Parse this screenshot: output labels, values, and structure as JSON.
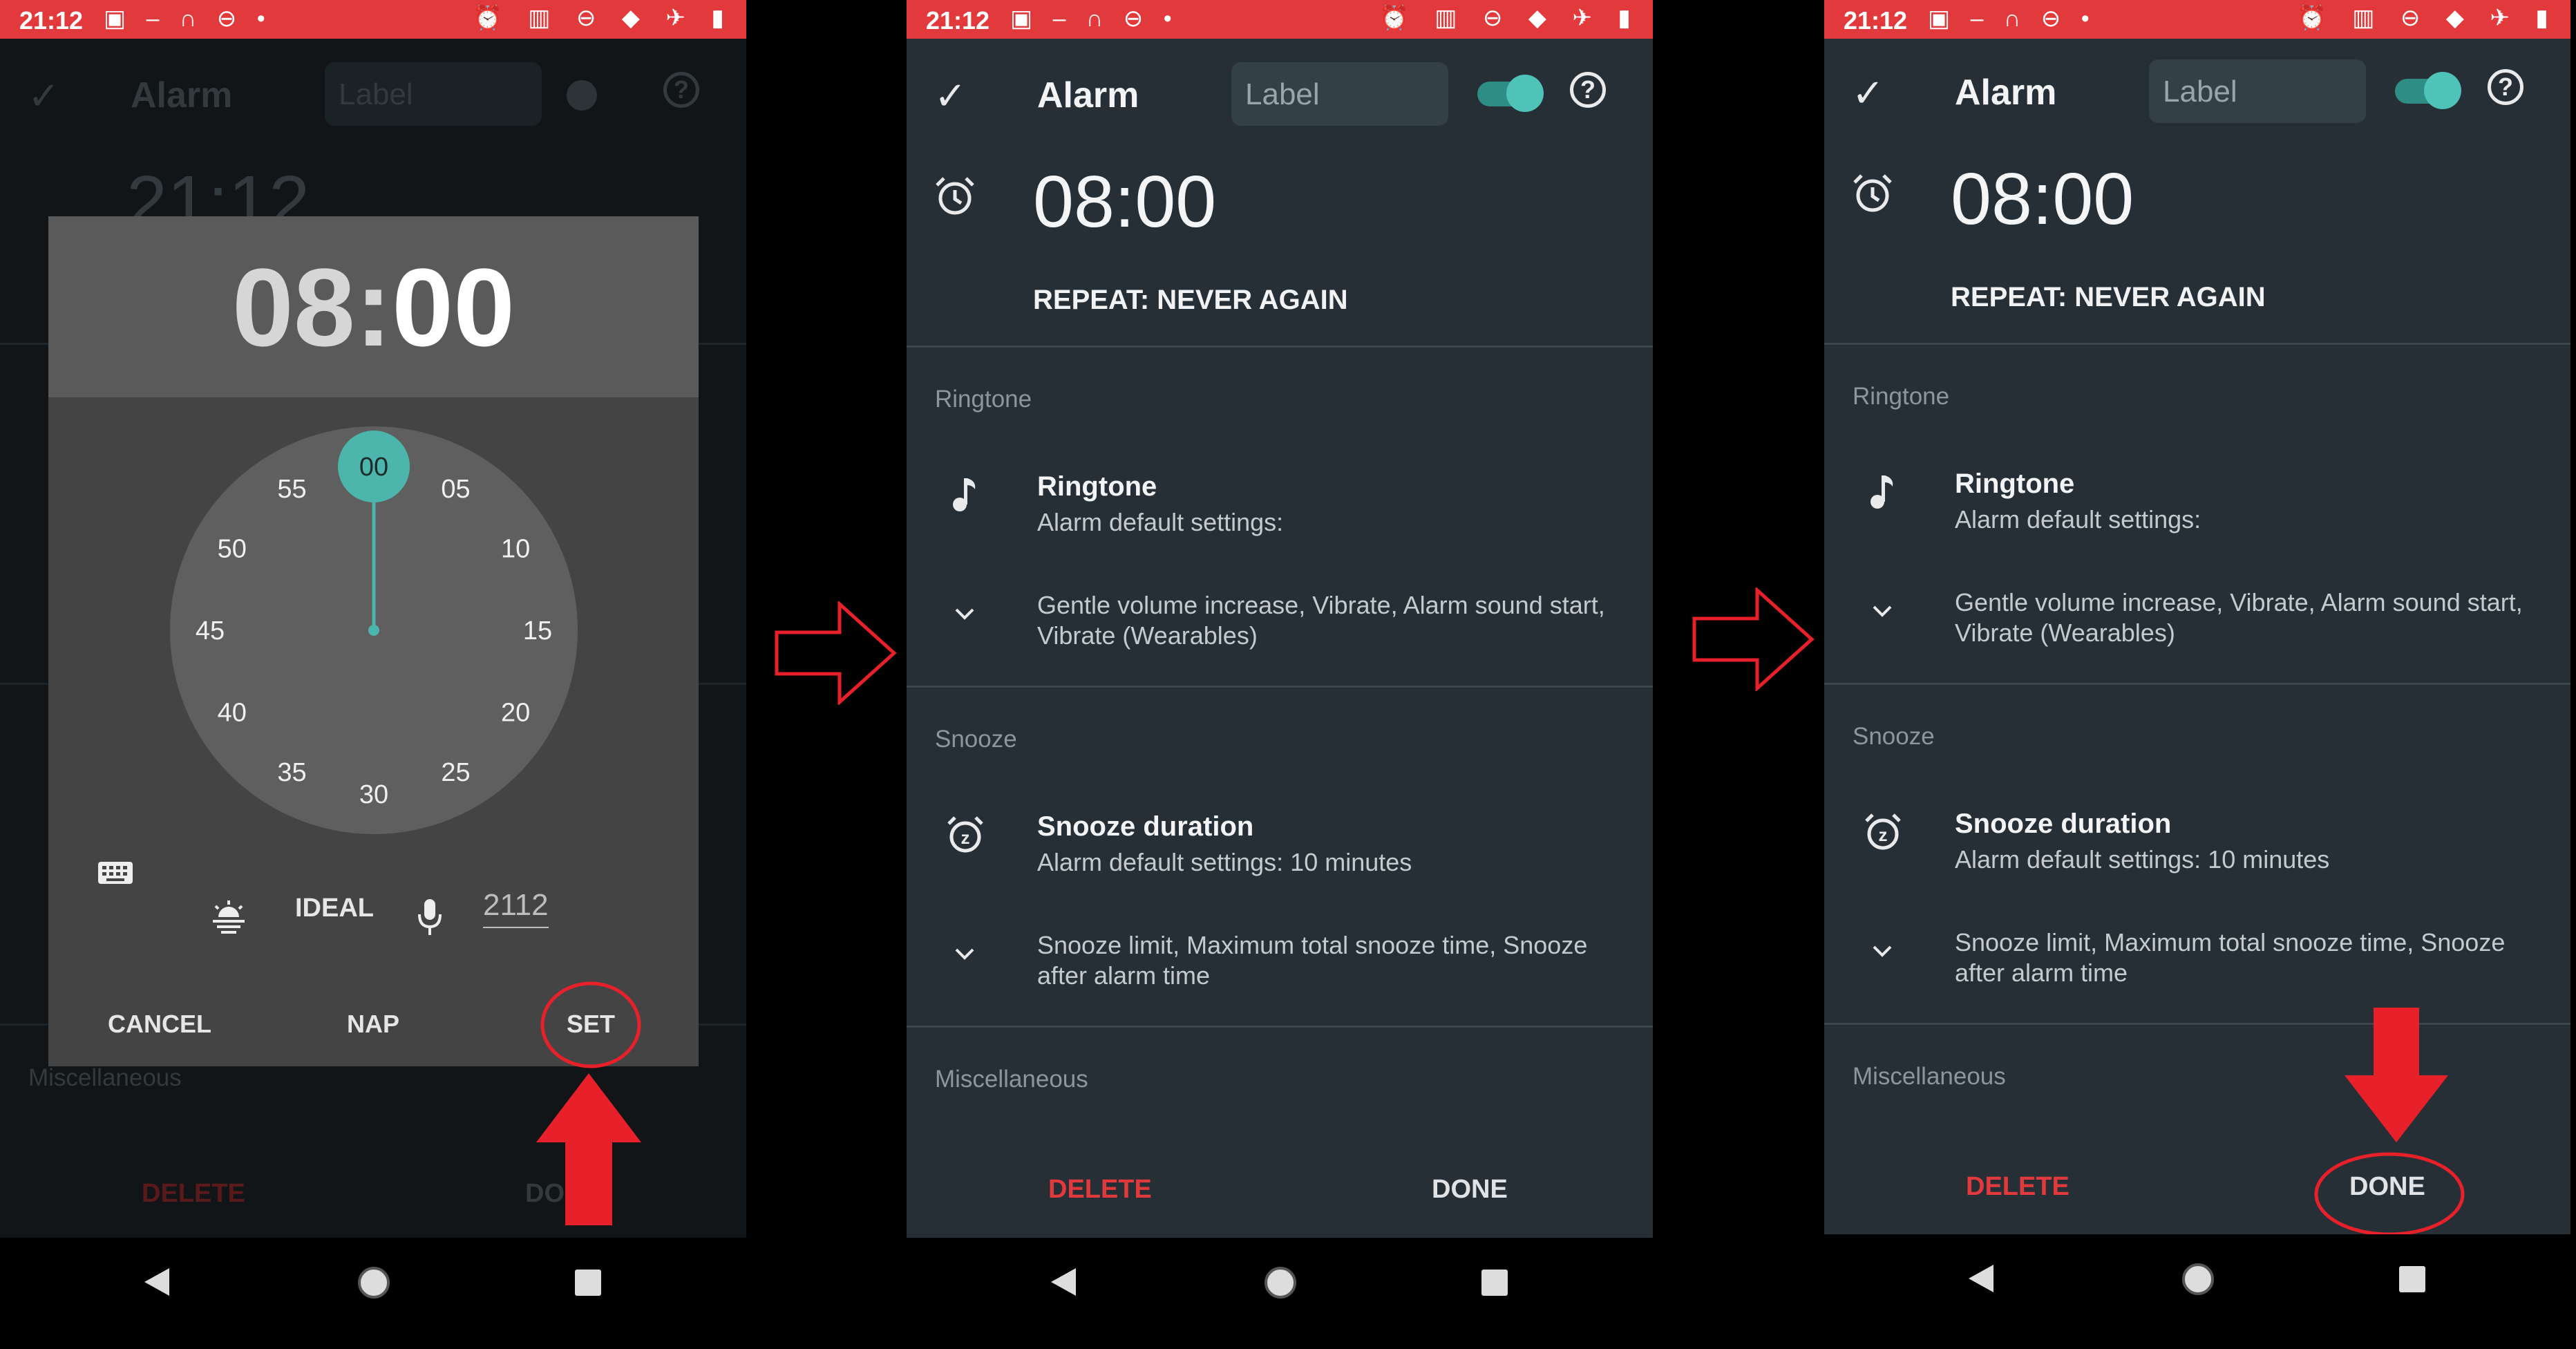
{
  "status_bar": {
    "time": "21:12",
    "left_icons": "▣ – ∩ ⊖ •",
    "right_icons": "⏰ ▥ ⊖ ◆ ✈ ▮"
  },
  "app": {
    "title": "Alarm",
    "label_placeholder": "Label",
    "help_label": "?",
    "background_time": "21:12",
    "alarm_time": "08:00",
    "repeat": "REPEAT: NEVER AGAIN",
    "sections": {
      "ringtone_header": "Ringtone",
      "ringtone_title": "Ringtone",
      "ringtone_sub": "Alarm default settings:",
      "ringtone_more": "Gentle volume increase, Vibrate, Alarm sound start, Vibrate (Wearables)",
      "snooze_header": "Snooze",
      "snooze_title": "Snooze duration",
      "snooze_sub": "Alarm default settings: 10 minutes",
      "snooze_more": "Snooze limit, Maximum total snooze time, Snooze after alarm time",
      "misc_header": "Miscellaneous"
    },
    "footer": {
      "delete": "DELETE",
      "done": "DONE"
    }
  },
  "time_picker": {
    "hour": "08",
    "separator": ":",
    "minute": "00",
    "selected_minute": "00",
    "dial_labels": [
      "00",
      "05",
      "10",
      "15",
      "20",
      "25",
      "30",
      "35",
      "40",
      "45",
      "50",
      "55"
    ],
    "ideal_label": "IDEAL",
    "voice_value": "2112",
    "buttons": {
      "cancel": "CANCEL",
      "nap": "NAP",
      "set": "SET"
    }
  },
  "colors": {
    "accent": "#4db6ac",
    "status_bar": "#e23a3c",
    "screen_bg": "#262f35",
    "annotation": "#e8202a"
  }
}
